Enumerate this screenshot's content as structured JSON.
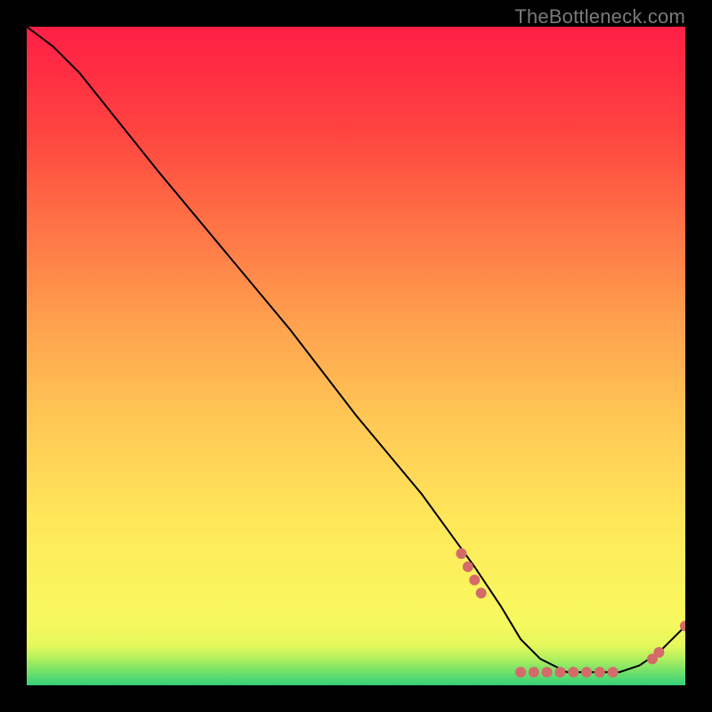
{
  "watermark": "TheBottleneck.com",
  "chart_data": {
    "type": "line",
    "title": "",
    "xlabel": "",
    "ylabel": "",
    "xlim": [
      0,
      100
    ],
    "ylim": [
      0,
      100
    ],
    "grid": false,
    "legend": false,
    "gradient_stops": [
      {
        "offset": 0,
        "color": "#33d17a"
      },
      {
        "offset": 2,
        "color": "#6fe06a"
      },
      {
        "offset": 4,
        "color": "#b0ef5f"
      },
      {
        "offset": 6,
        "color": "#e4f85c"
      },
      {
        "offset": 10,
        "color": "#f8f95e"
      },
      {
        "offset": 25,
        "color": "#ffe75a"
      },
      {
        "offset": 40,
        "color": "#ffc855"
      },
      {
        "offset": 55,
        "color": "#ffa14e"
      },
      {
        "offset": 70,
        "color": "#ff7246"
      },
      {
        "offset": 85,
        "color": "#ff4140"
      },
      {
        "offset": 100,
        "color": "#ff1f46"
      }
    ],
    "series": [
      {
        "name": "curve",
        "x": [
          0,
          4,
          8,
          12,
          20,
          30,
          40,
          50,
          60,
          68,
          72,
          75,
          78,
          82,
          86,
          90,
          93,
          96,
          98,
          100
        ],
        "y": [
          100,
          97,
          93,
          88,
          78,
          66,
          54,
          41,
          29,
          18,
          12,
          7,
          4,
          2,
          2,
          2,
          3,
          5,
          7,
          9
        ]
      }
    ],
    "markers": {
      "cluster_left": {
        "x": [
          66,
          67,
          68,
          69
        ],
        "y": [
          20,
          18,
          16,
          14
        ]
      },
      "cluster_bottom": {
        "x": [
          75,
          77,
          79,
          81,
          83,
          85,
          87,
          89
        ],
        "y": [
          2,
          2,
          2,
          2,
          2,
          2,
          2,
          2
        ]
      },
      "cluster_right": {
        "x": [
          95,
          96,
          100
        ],
        "y": [
          4,
          5,
          9
        ]
      }
    },
    "marker_color": "#d46a6a",
    "line_color": "#000000"
  }
}
